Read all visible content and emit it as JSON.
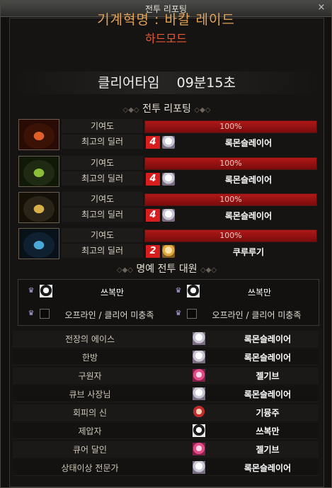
{
  "window": {
    "title": "전투 리포팅",
    "close_label": "×"
  },
  "raid": {
    "name": "기계혁명 : 바칼 레이드",
    "mode": "하드모드"
  },
  "clear_time": {
    "label": "클리어타임",
    "value": "09분15초"
  },
  "section_battle": "전투 리포팅",
  "section_honor": "명예 전투 대원",
  "row_labels": {
    "contribution": "기여도",
    "top_dealer": "최고의 딜러"
  },
  "bosses": [
    {
      "name": "boss-1",
      "contribution_pct": 100,
      "contribution_text": "100%",
      "dealer_rank": "4",
      "dealer_avatar": "white-hair-avatar",
      "dealer_name": "록몬슬레이어",
      "palette": [
        "#3a1206",
        "#e0602a",
        "#2a0a05"
      ]
    },
    {
      "name": "boss-2",
      "contribution_pct": 100,
      "contribution_text": "100%",
      "dealer_rank": "4",
      "dealer_avatar": "white-hair-avatar",
      "dealer_name": "록몬슬레이어",
      "palette": [
        "#1f2a12",
        "#8bbf3a",
        "#101808"
      ]
    },
    {
      "name": "boss-3",
      "contribution_pct": 100,
      "contribution_text": "100%",
      "dealer_rank": "4",
      "dealer_avatar": "white-hair-avatar",
      "dealer_name": "록몬슬레이어",
      "palette": [
        "#2a2418",
        "#d8b04a",
        "#141008"
      ]
    },
    {
      "name": "boss-4",
      "contribution_pct": 100,
      "contribution_text": "100%",
      "dealer_rank": "2",
      "dealer_avatar": "gold-hair-avatar",
      "dealer_name": "쿠루루기",
      "palette": [
        "#0f2030",
        "#4aa7d8",
        "#081018"
      ]
    }
  ],
  "honor_members": [
    {
      "name": "쓰복만",
      "online": true,
      "avatar": "black-white-avatar"
    },
    {
      "name": "쓰복만",
      "online": true,
      "avatar": "black-white-avatar"
    },
    {
      "name": "오프라인 / 클리어 미충족",
      "online": false
    },
    {
      "name": "오프라인 / 클리어 미충족",
      "online": false
    }
  ],
  "awards": [
    {
      "title": "전장의 에이스",
      "avatar": "white-hair-avatar",
      "player": "록몬슬레이어"
    },
    {
      "title": "한방",
      "avatar": "white-hair-avatar",
      "player": "록몬슬레이어"
    },
    {
      "title": "구원자",
      "avatar": "pink-hair-avatar",
      "player": "젤기브"
    },
    {
      "title": "큐브 사장님",
      "avatar": "white-hair-avatar",
      "player": "록몬슬레이어"
    },
    {
      "title": "회피의 신",
      "avatar": "red-hair-avatar",
      "player": "기뮹주"
    },
    {
      "title": "제압자",
      "avatar": "black-white-avatar",
      "player": "쓰복만"
    },
    {
      "title": "큐어 달인",
      "avatar": "pink-hair-avatar",
      "player": "젤기브"
    },
    {
      "title": "상태이상 전문가",
      "avatar": "white-hair-avatar",
      "player": "록몬슬레이어"
    }
  ],
  "colors": {
    "accent_gold": "#e3a458",
    "accent_red": "#e25a34",
    "bar_red": "#b01818",
    "rank_badge": "#d81d1d"
  }
}
